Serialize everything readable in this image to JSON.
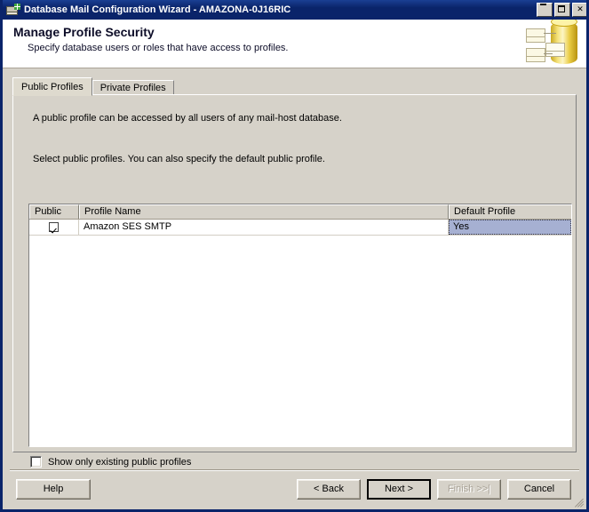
{
  "window": {
    "title": "Database Mail Configuration Wizard - AMAZONA-0J16RIC",
    "icon": "mail-database-icon",
    "controls": {
      "minimize_label": "_",
      "maximize_label": "□",
      "close_label": "✕"
    }
  },
  "banner": {
    "heading": "Manage Profile Security",
    "subheading": "Specify database users or roles that have access to profiles.",
    "art": "database-cylinder-envelopes-icon"
  },
  "tabs": [
    {
      "label": "Public Profiles",
      "selected": true
    },
    {
      "label": "Private Profiles",
      "selected": false
    }
  ],
  "panel": {
    "description_1": "A public profile can be accessed by all users of any mail-host database.",
    "description_2": "Select public profiles. You can also specify the default public profile."
  },
  "grid": {
    "columns": [
      "Public",
      "Profile Name",
      "Default Profile"
    ],
    "rows": [
      {
        "public_checked": true,
        "profile_name": "Amazon SES SMTP",
        "default_profile": "Yes",
        "default_profile_selected": true
      }
    ],
    "selection_color": "#a6b0d2"
  },
  "options": {
    "show_only_existing": {
      "label": "Show only existing public profiles",
      "checked": false
    }
  },
  "footer": {
    "help": "Help",
    "back": "< Back",
    "next": "Next >",
    "finish": "Finish >>|",
    "cancel": "Cancel",
    "default_button": "Next >",
    "disabled_button": "Finish >>|"
  },
  "colors": {
    "titlebar": "#0a246a",
    "face": "#d6d2c9",
    "grid_selection": "#a6b0d2",
    "banner_background": "#ffffff"
  }
}
